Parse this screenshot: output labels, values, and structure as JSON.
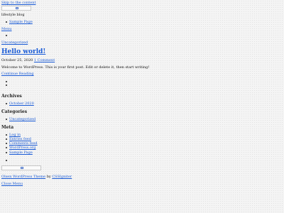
{
  "header": {
    "skip_link": "Skip to the content",
    "site_title": "lifestyle blog",
    "nav": [
      "Sample Page"
    ],
    "menu_label": "Menu"
  },
  "post": {
    "category": "Uncategorized",
    "title": "Hello world!",
    "date": "October 25, 2020",
    "comments": "1 Comment",
    "content": "Welcome to WordPress. This is your first post. Edit or delete it, then start writing!",
    "continue": "Continue Reading"
  },
  "sidebar": {
    "archives": {
      "heading": "Archives",
      "items": [
        "October 2020"
      ]
    },
    "categories": {
      "heading": "Categories",
      "items": [
        "Uncategorized"
      ]
    },
    "meta": {
      "heading": "Meta",
      "items": [
        "Log in",
        "Entries feed",
        "Comments feed",
        "WordPress.org"
      ]
    }
  },
  "footer_nav": [
    "Sample Page"
  ],
  "footer": {
    "theme_link": "Olsen WordPress Theme",
    "by": "by",
    "author_link": "CSSIgniter",
    "close_menu": "Close Menu"
  },
  "colors": {
    "link": "#1a5bd6",
    "text": "#111111",
    "background": "#f4f4f4"
  }
}
